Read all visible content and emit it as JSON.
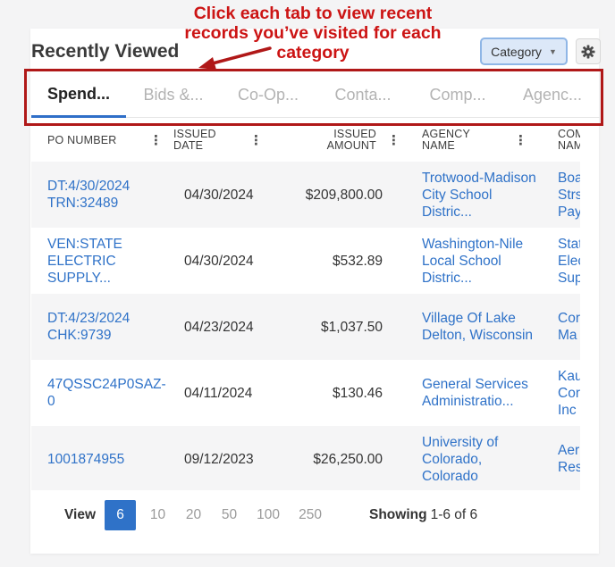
{
  "annotation": {
    "line1": "Click each tab to view recent",
    "line2": "records you’ve visited for each",
    "line3": "category",
    "color": "#cc1414"
  },
  "card": {
    "title": "Recently Viewed"
  },
  "category_button": {
    "label": "Category",
    "icon": "chevron-down-icon"
  },
  "settings_button": {
    "icon": "gear-icon"
  },
  "tabs": [
    {
      "label": "Spend...",
      "active": true
    },
    {
      "label": "Bids &...",
      "active": false
    },
    {
      "label": "Co-Op...",
      "active": false
    },
    {
      "label": "Conta...",
      "active": false
    },
    {
      "label": "Comp...",
      "active": false
    },
    {
      "label": "Agenc...",
      "active": false
    }
  ],
  "table": {
    "columns": [
      {
        "label": "PO NUMBER",
        "line2": ""
      },
      {
        "label": "ISSUED",
        "line2": "DATE"
      },
      {
        "label": "ISSUED",
        "line2": "AMOUNT"
      },
      {
        "label": "AGENCY",
        "line2": "NAME"
      },
      {
        "label": "COM",
        "line2": "NAM"
      }
    ],
    "rows": [
      {
        "po_number": "DT:4/30/2024 TRN:32489",
        "issued_date": "04/30/2024",
        "issued_amount": "$209,800.00",
        "agency_name": "Trotwood-Madison City School Distric...",
        "company_line1": "Boa",
        "company_line2": "Strs",
        "company_line3": "Pay"
      },
      {
        "po_number": "VEN:STATE ELECTRIC SUPPLY...",
        "issued_date": "04/30/2024",
        "issued_amount": "$532.89",
        "agency_name": "Washington-Nile Local School Distric...",
        "company_line1": "Stat",
        "company_line2": "Elec",
        "company_line3": "Sup"
      },
      {
        "po_number": "DT:4/23/2024 CHK:9739",
        "issued_date": "04/23/2024",
        "issued_amount": "$1,037.50",
        "agency_name": "Village Of Lake Delton, Wisconsin",
        "company_line1": "Cor",
        "company_line2": "Ma",
        "company_line3": ""
      },
      {
        "po_number": "47QSSC24P0SAZ-0",
        "issued_date": "04/11/2024",
        "issued_amount": "$130.46",
        "agency_name": "General Services Administratio...",
        "company_line1": "Kau",
        "company_line2": "Cor",
        "company_line3": "Inc"
      },
      {
        "po_number": "1001874955",
        "issued_date": "09/12/2023",
        "issued_amount": "$26,250.00",
        "agency_name": "University of Colorado, Colorado",
        "company_line1": "Aer",
        "company_line2": "Res",
        "company_line3": ""
      }
    ]
  },
  "pagination": {
    "view_label": "View",
    "page_sizes": [
      "6",
      "10",
      "20",
      "50",
      "100",
      "250"
    ],
    "active_page_size": "6",
    "showing_label": "Showing",
    "showing_value": "1-6 of 6"
  },
  "colors": {
    "accent": "#2f72c8",
    "annotation_red": "#cc1414",
    "highlight_border": "#b01818"
  }
}
